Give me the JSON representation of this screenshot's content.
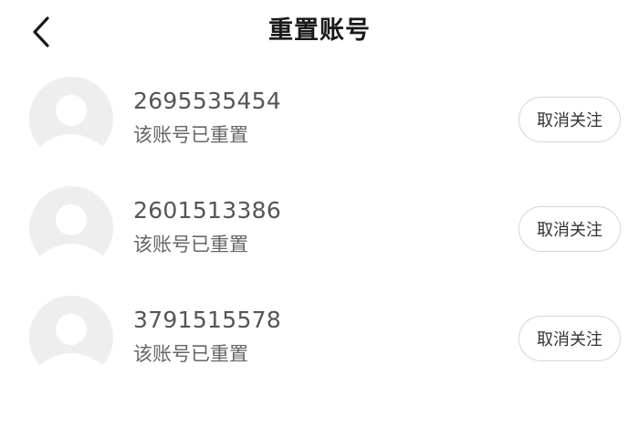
{
  "header": {
    "title": "重置账号",
    "back_icon": "chevron-left-icon"
  },
  "accounts": [
    {
      "id": "2695535454",
      "status": "该账号已重置",
      "action_label": "取消关注",
      "avatar_icon": "default-avatar-icon"
    },
    {
      "id": "2601513386",
      "status": "该账号已重置",
      "action_label": "取消关注",
      "avatar_icon": "default-avatar-icon"
    },
    {
      "id": "3791515578",
      "status": "该账号已重置",
      "action_label": "取消关注",
      "avatar_icon": "default-avatar-icon"
    }
  ],
  "colors": {
    "background": "#ffffff",
    "avatar_bg": "#eeeeee",
    "avatar_figure": "#ffffff",
    "title_text": "#1a1a1a",
    "id_text": "#555555",
    "status_text": "#666666",
    "button_border": "#d4d4d4",
    "button_text": "#333333"
  }
}
